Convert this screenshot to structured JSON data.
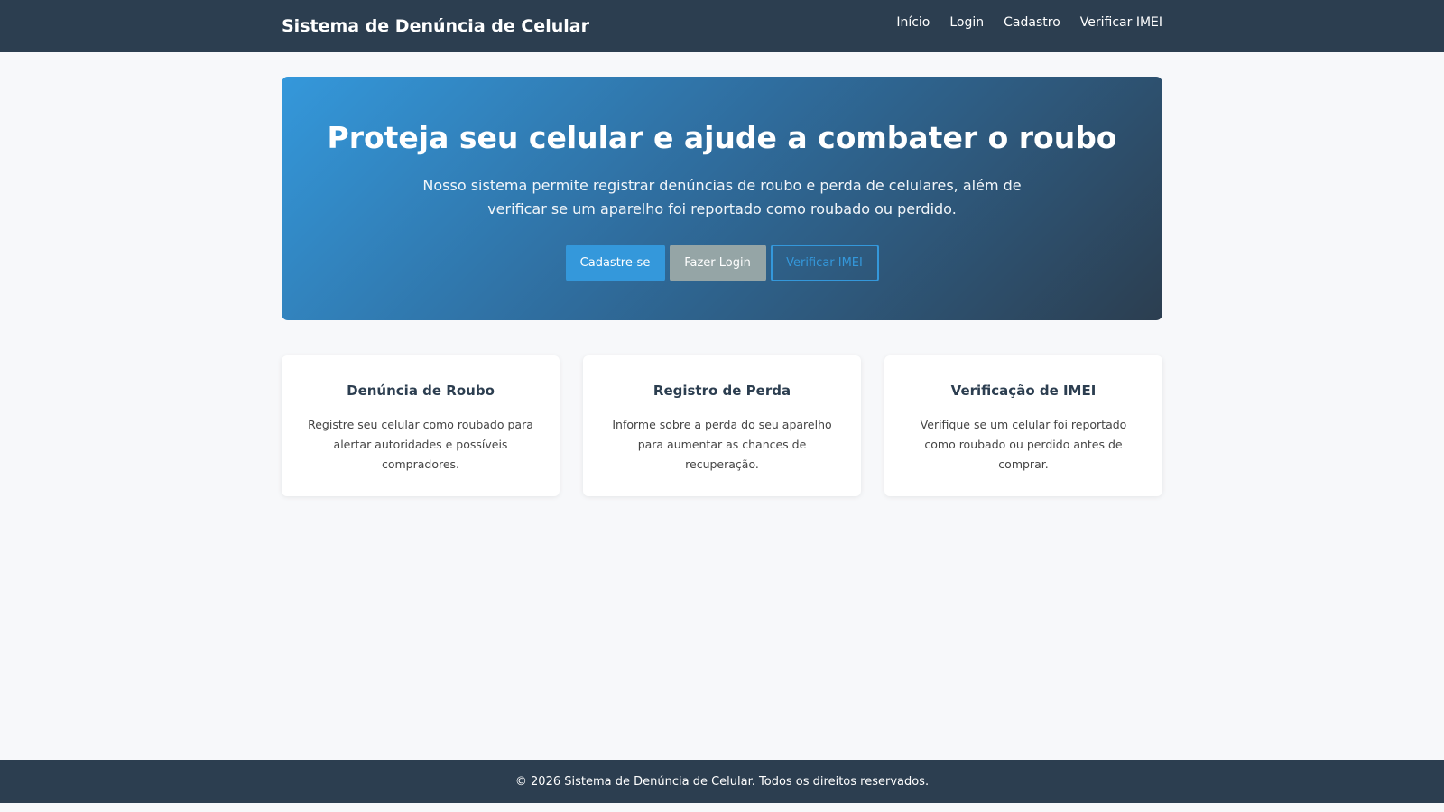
{
  "navbar": {
    "brand": "Sistema de Denúncia de Celular",
    "links": [
      {
        "label": "Início"
      },
      {
        "label": "Login"
      },
      {
        "label": "Cadastro"
      },
      {
        "label": "Verificar IMEI"
      }
    ]
  },
  "hero": {
    "title": "Proteja seu celular e ajude a combater o roubo",
    "description": "Nosso sistema permite registrar denúncias de roubo e perda de celulares, além de verificar se um aparelho foi reportado como roubado ou perdido.",
    "buttons": {
      "register": "Cadastre-se",
      "login": "Fazer Login",
      "verify": "Verificar IMEI"
    }
  },
  "cards": [
    {
      "title": "Denúncia de Roubo",
      "text": "Registre seu celular como roubado para alertar autoridades e possíveis compradores."
    },
    {
      "title": "Registro de Perda",
      "text": "Informe sobre a perda do seu aparelho para aumentar as chances de recuperação."
    },
    {
      "title": "Verificação de IMEI",
      "text": "Verifique se um celular foi reportado como roubado ou perdido antes de comprar."
    }
  ],
  "footer": {
    "text": "© 2026 Sistema de Denúncia de Celular. Todos os direitos reservados."
  },
  "colors": {
    "navbar": "#2c3e50",
    "accent": "#3498db",
    "secondary_button": "#95a5a6",
    "page_background": "#f7f8fa"
  }
}
